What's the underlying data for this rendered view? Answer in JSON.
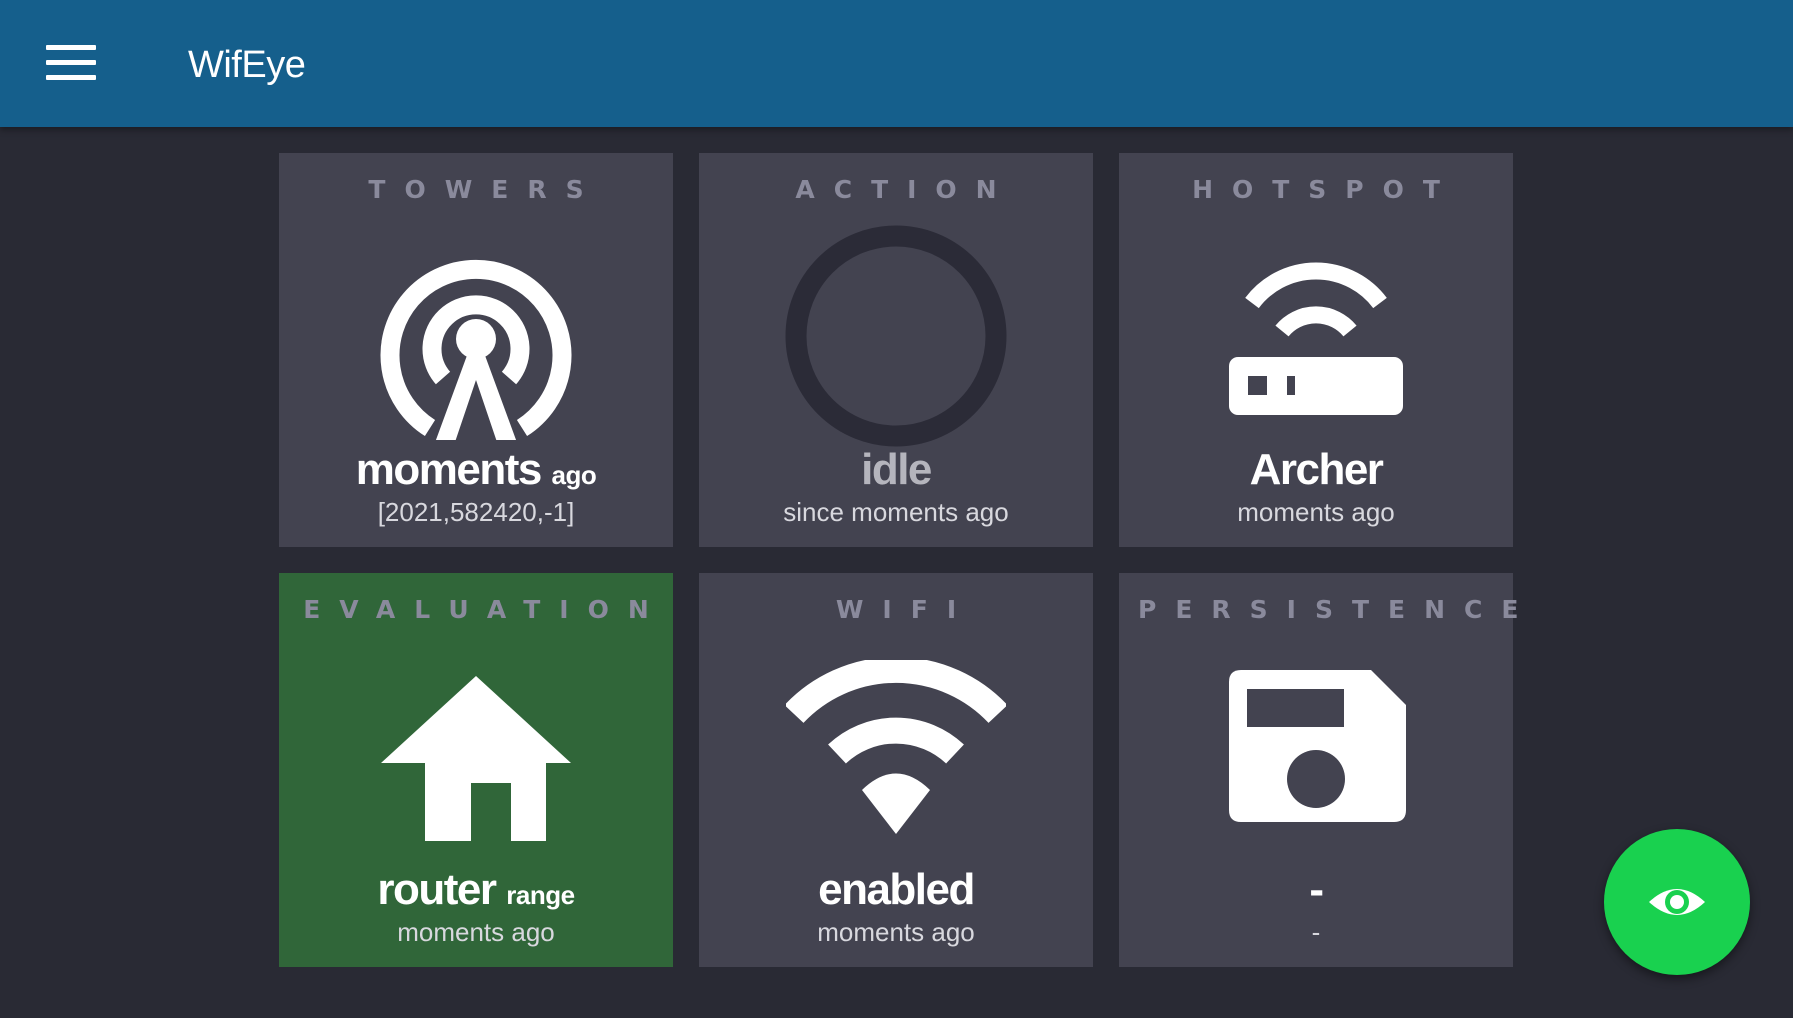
{
  "app": {
    "title": "WifEye",
    "menu_icon": "hamburger-menu-icon",
    "colors": {
      "appbar": "#155f8c",
      "background": "#292a34",
      "tile": "#434350",
      "tile_active": "#306639",
      "fab": "#19d14f"
    }
  },
  "tiles": {
    "towers": {
      "title": "TOWERS",
      "icon": "radio-tower-icon",
      "main": "moments",
      "suffix": "ago",
      "sub": "[2021,582420,-1]"
    },
    "action": {
      "title": "ACTION",
      "icon": "circle-ring-icon",
      "main": "idle",
      "sub": "since moments ago"
    },
    "hotspot": {
      "title": "HOTSPOT",
      "icon": "router-icon",
      "main": "Archer",
      "sub": "moments ago"
    },
    "evaluation": {
      "title": "EVALUATION",
      "icon": "home-icon",
      "main": "router",
      "suffix": "range",
      "sub": "moments ago"
    },
    "wifi": {
      "title": "WIFI",
      "icon": "wifi-icon",
      "main": "enabled",
      "sub": "moments ago"
    },
    "persistence": {
      "title": "PERSISTENCE",
      "icon": "floppy-disk-icon",
      "main": "-",
      "sub": "-"
    }
  },
  "fab": {
    "icon": "eye-icon"
  }
}
